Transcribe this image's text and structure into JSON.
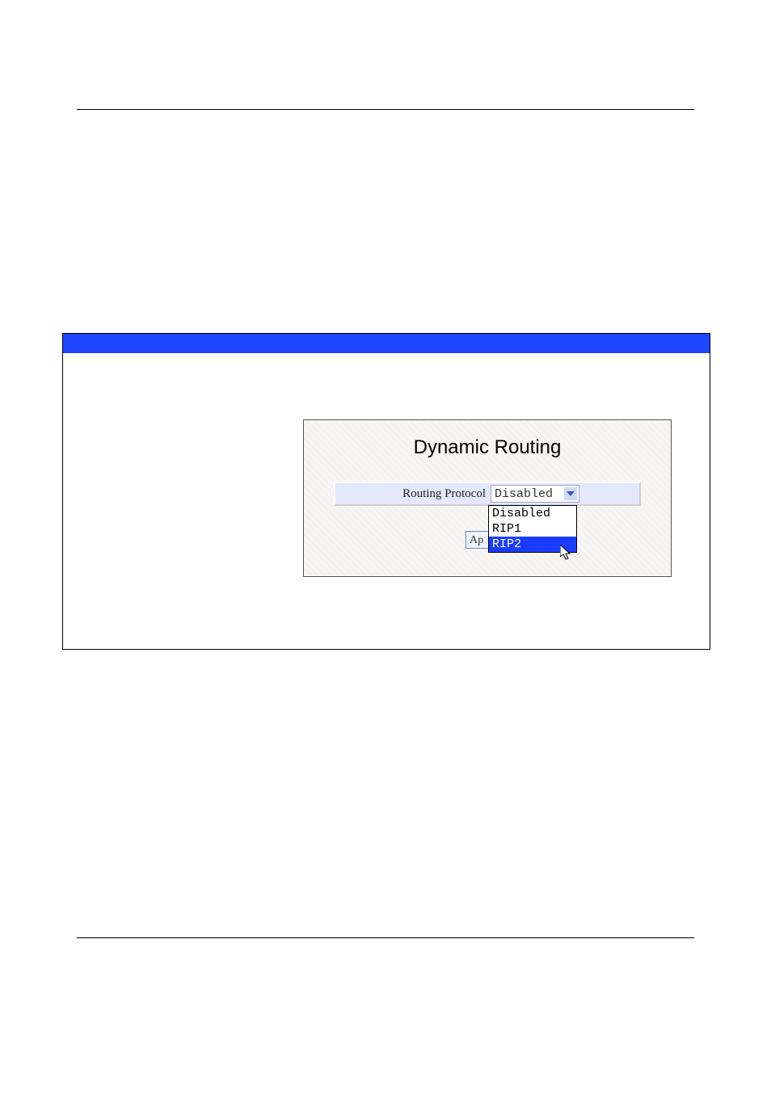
{
  "panel": {
    "title": "Dynamic Routing",
    "field_label": "Routing Protocol",
    "selected_value": "Disabled",
    "options": {
      "opt0": "Disabled",
      "opt1": "RIP1",
      "opt2": "RIP2"
    },
    "highlighted_option": "RIP2",
    "apply_button_visible_text": "Ap"
  }
}
